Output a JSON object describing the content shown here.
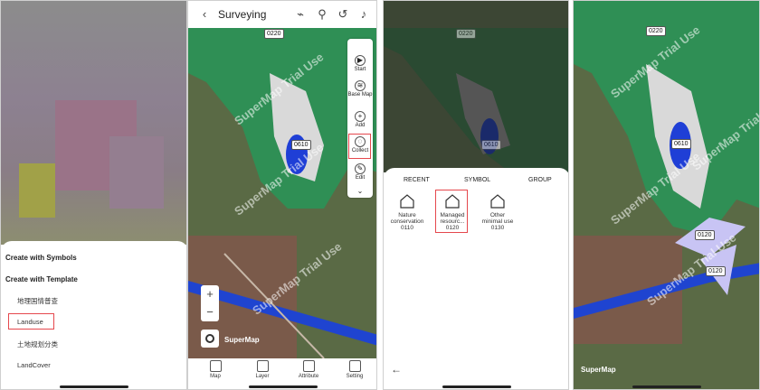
{
  "panel1": {
    "sheet": {
      "header_symbols": "Create with Symbols",
      "header_template": "Create with Template",
      "templates": [
        "地理国情普查",
        "Landuse",
        "土地规划分类",
        "LandCover"
      ]
    }
  },
  "panel2": {
    "title": "Surveying",
    "map_labels": [
      "0220",
      "0610"
    ],
    "watermark": "SuperMap Trial Use",
    "logo": "SuperMap",
    "tools": [
      "Start",
      "Base Map",
      "Add",
      "Collect",
      "Edit"
    ],
    "nav": [
      "Map",
      "Layer",
      "Attribute",
      "Setting"
    ]
  },
  "panel3": {
    "map_labels": [
      "0220",
      "0610"
    ],
    "tabs": [
      "RECENT",
      "SYMBOL",
      "GROUP"
    ],
    "symbols": [
      {
        "name": "Nature conservation",
        "code": "0110"
      },
      {
        "name": "Managed resourc...",
        "code": "0120"
      },
      {
        "name": "Other minimal use",
        "code": "0130"
      }
    ]
  },
  "panel4": {
    "map_labels": [
      "0220",
      "0610",
      "0120",
      "0120"
    ],
    "watermark": "SuperMap Trial Use",
    "logo": "SuperMap"
  },
  "colors": {
    "highlight": "#e5484d",
    "green_zone": "#2e8b57",
    "water": "#1f3fd6",
    "polygon": "#c8c4f4"
  }
}
